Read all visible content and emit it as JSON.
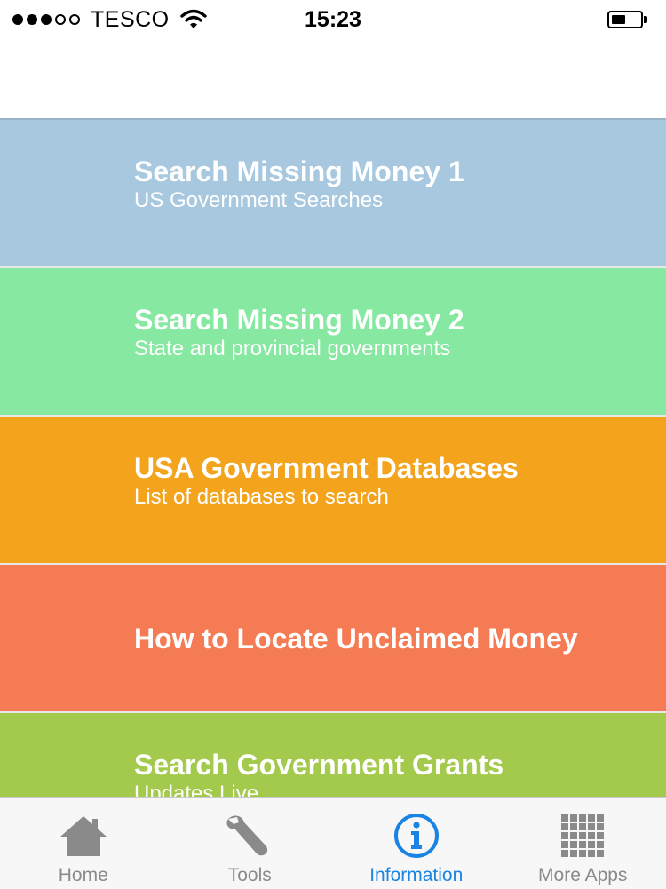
{
  "status_bar": {
    "carrier": "TESCO",
    "time": "15:23",
    "signal_bars_filled": 3,
    "signal_bars_total": 5,
    "battery_level": 0.45
  },
  "menu": {
    "items": [
      {
        "title": "Search Missing Money 1",
        "subtitle": "US Government Searches",
        "color": "#a8c8e0"
      },
      {
        "title": "Search Missing Money 2",
        "subtitle": "State and provincial governments",
        "color": "#86e8a1"
      },
      {
        "title": "USA Government Databases",
        "subtitle": "List of databases to search",
        "color": "#f3a41c"
      },
      {
        "title": "How to Locate Unclaimed Money",
        "subtitle": "",
        "color": "#f57b54"
      },
      {
        "title": "Search Government Grants",
        "subtitle": "Updates Live",
        "color": "#a4ca4d"
      }
    ]
  },
  "tab_bar": {
    "active_color": "#1a84e4",
    "inactive_color": "#8a8a8a",
    "tabs": [
      {
        "label": "Home",
        "icon": "house-icon"
      },
      {
        "label": "Tools",
        "icon": "wrench-icon"
      },
      {
        "label": "Information",
        "icon": "info-icon",
        "active": true
      },
      {
        "label": "More Apps",
        "icon": "grid-icon"
      }
    ]
  }
}
